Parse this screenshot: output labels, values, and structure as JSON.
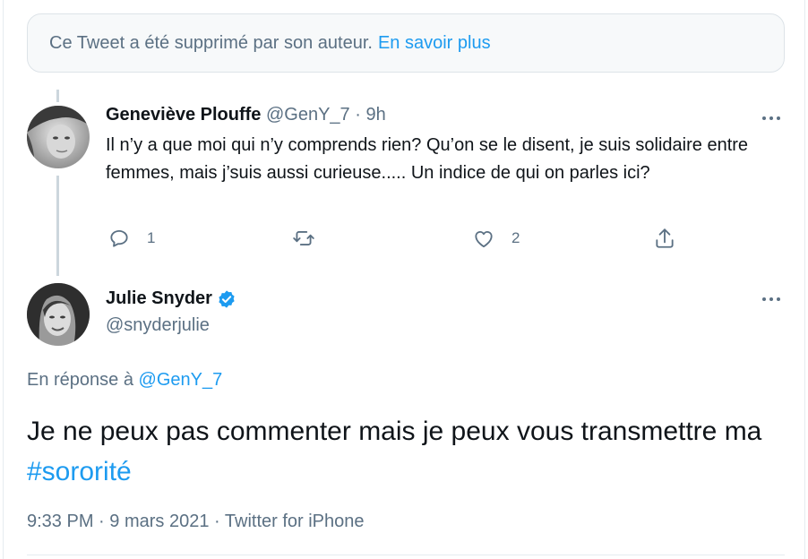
{
  "deleted_notice": {
    "text": "Ce Tweet a été supprimé par son auteur.",
    "link": "En savoir plus"
  },
  "reply": {
    "name": "Geneviève Plouffe",
    "handle": "@GenY_7",
    "separator": "·",
    "time": "9h",
    "text": "Il n’y a que moi qui n’y comprends rien? Qu’on se le disent, je suis solidaire entre femmes, mais j’suis aussi curieuse..... Un indice de qui on parles ici?",
    "reply_count": "1",
    "like_count": "2",
    "icons": [
      "reply-icon",
      "retweet-icon",
      "like-icon",
      "share-icon",
      "more-icon"
    ]
  },
  "main_tweet": {
    "name": "Julie Snyder",
    "handle": "@snyderjulie",
    "verified": true,
    "in_reply_prefix": "En réponse à",
    "in_reply_handle": "@GenY_7",
    "text": "Je ne peux pas commenter mais je peux vous transmettre ma",
    "hashtag": "#sororité",
    "time": "9:33 PM",
    "date": "9 mars 2021",
    "source": "Twitter for iPhone",
    "dot": "·"
  },
  "colors": {
    "accent": "#1d9bf0",
    "muted": "#5b7083",
    "text": "#0f1419"
  }
}
